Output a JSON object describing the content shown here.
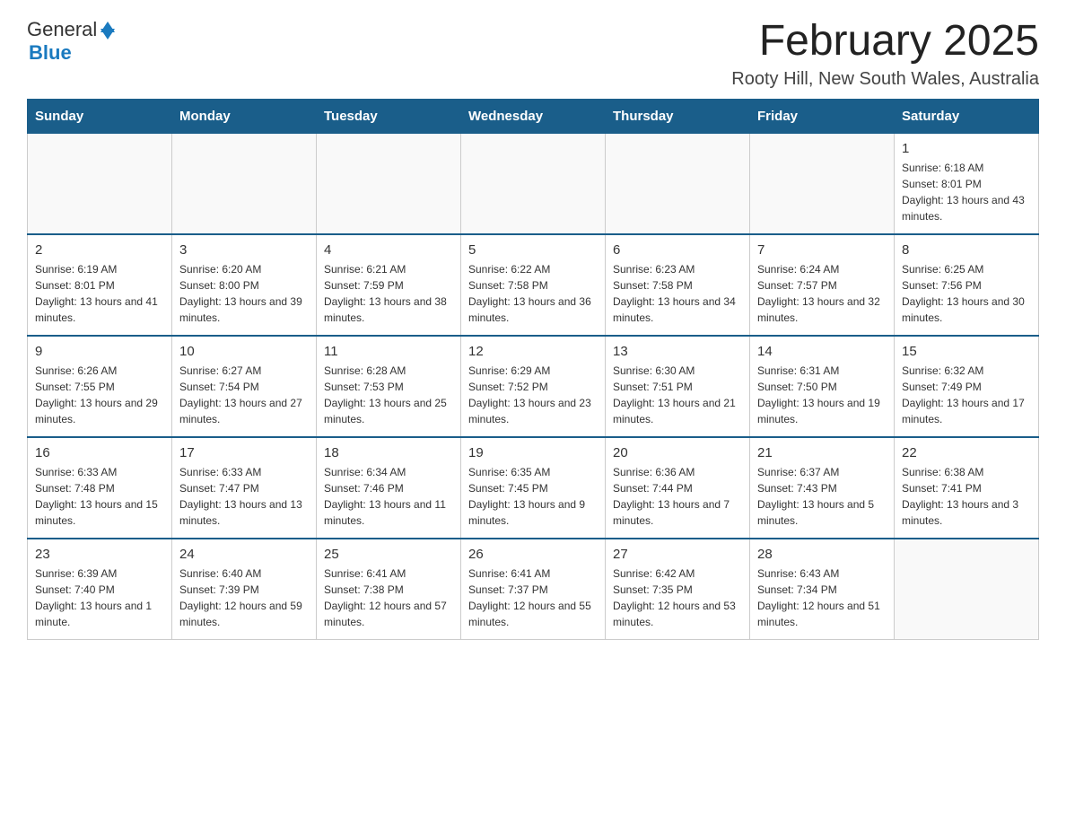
{
  "logo": {
    "text_general": "General",
    "text_blue": "Blue"
  },
  "header": {
    "month_year": "February 2025",
    "location": "Rooty Hill, New South Wales, Australia"
  },
  "days_of_week": [
    "Sunday",
    "Monday",
    "Tuesday",
    "Wednesday",
    "Thursday",
    "Friday",
    "Saturday"
  ],
  "weeks": [
    {
      "days": [
        {
          "num": "",
          "info": ""
        },
        {
          "num": "",
          "info": ""
        },
        {
          "num": "",
          "info": ""
        },
        {
          "num": "",
          "info": ""
        },
        {
          "num": "",
          "info": ""
        },
        {
          "num": "",
          "info": ""
        },
        {
          "num": "1",
          "info": "Sunrise: 6:18 AM\nSunset: 8:01 PM\nDaylight: 13 hours and 43 minutes."
        }
      ]
    },
    {
      "days": [
        {
          "num": "2",
          "info": "Sunrise: 6:19 AM\nSunset: 8:01 PM\nDaylight: 13 hours and 41 minutes."
        },
        {
          "num": "3",
          "info": "Sunrise: 6:20 AM\nSunset: 8:00 PM\nDaylight: 13 hours and 39 minutes."
        },
        {
          "num": "4",
          "info": "Sunrise: 6:21 AM\nSunset: 7:59 PM\nDaylight: 13 hours and 38 minutes."
        },
        {
          "num": "5",
          "info": "Sunrise: 6:22 AM\nSunset: 7:58 PM\nDaylight: 13 hours and 36 minutes."
        },
        {
          "num": "6",
          "info": "Sunrise: 6:23 AM\nSunset: 7:58 PM\nDaylight: 13 hours and 34 minutes."
        },
        {
          "num": "7",
          "info": "Sunrise: 6:24 AM\nSunset: 7:57 PM\nDaylight: 13 hours and 32 minutes."
        },
        {
          "num": "8",
          "info": "Sunrise: 6:25 AM\nSunset: 7:56 PM\nDaylight: 13 hours and 30 minutes."
        }
      ]
    },
    {
      "days": [
        {
          "num": "9",
          "info": "Sunrise: 6:26 AM\nSunset: 7:55 PM\nDaylight: 13 hours and 29 minutes."
        },
        {
          "num": "10",
          "info": "Sunrise: 6:27 AM\nSunset: 7:54 PM\nDaylight: 13 hours and 27 minutes."
        },
        {
          "num": "11",
          "info": "Sunrise: 6:28 AM\nSunset: 7:53 PM\nDaylight: 13 hours and 25 minutes."
        },
        {
          "num": "12",
          "info": "Sunrise: 6:29 AM\nSunset: 7:52 PM\nDaylight: 13 hours and 23 minutes."
        },
        {
          "num": "13",
          "info": "Sunrise: 6:30 AM\nSunset: 7:51 PM\nDaylight: 13 hours and 21 minutes."
        },
        {
          "num": "14",
          "info": "Sunrise: 6:31 AM\nSunset: 7:50 PM\nDaylight: 13 hours and 19 minutes."
        },
        {
          "num": "15",
          "info": "Sunrise: 6:32 AM\nSunset: 7:49 PM\nDaylight: 13 hours and 17 minutes."
        }
      ]
    },
    {
      "days": [
        {
          "num": "16",
          "info": "Sunrise: 6:33 AM\nSunset: 7:48 PM\nDaylight: 13 hours and 15 minutes."
        },
        {
          "num": "17",
          "info": "Sunrise: 6:33 AM\nSunset: 7:47 PM\nDaylight: 13 hours and 13 minutes."
        },
        {
          "num": "18",
          "info": "Sunrise: 6:34 AM\nSunset: 7:46 PM\nDaylight: 13 hours and 11 minutes."
        },
        {
          "num": "19",
          "info": "Sunrise: 6:35 AM\nSunset: 7:45 PM\nDaylight: 13 hours and 9 minutes."
        },
        {
          "num": "20",
          "info": "Sunrise: 6:36 AM\nSunset: 7:44 PM\nDaylight: 13 hours and 7 minutes."
        },
        {
          "num": "21",
          "info": "Sunrise: 6:37 AM\nSunset: 7:43 PM\nDaylight: 13 hours and 5 minutes."
        },
        {
          "num": "22",
          "info": "Sunrise: 6:38 AM\nSunset: 7:41 PM\nDaylight: 13 hours and 3 minutes."
        }
      ]
    },
    {
      "days": [
        {
          "num": "23",
          "info": "Sunrise: 6:39 AM\nSunset: 7:40 PM\nDaylight: 13 hours and 1 minute."
        },
        {
          "num": "24",
          "info": "Sunrise: 6:40 AM\nSunset: 7:39 PM\nDaylight: 12 hours and 59 minutes."
        },
        {
          "num": "25",
          "info": "Sunrise: 6:41 AM\nSunset: 7:38 PM\nDaylight: 12 hours and 57 minutes."
        },
        {
          "num": "26",
          "info": "Sunrise: 6:41 AM\nSunset: 7:37 PM\nDaylight: 12 hours and 55 minutes."
        },
        {
          "num": "27",
          "info": "Sunrise: 6:42 AM\nSunset: 7:35 PM\nDaylight: 12 hours and 53 minutes."
        },
        {
          "num": "28",
          "info": "Sunrise: 6:43 AM\nSunset: 7:34 PM\nDaylight: 12 hours and 51 minutes."
        },
        {
          "num": "",
          "info": ""
        }
      ]
    }
  ]
}
